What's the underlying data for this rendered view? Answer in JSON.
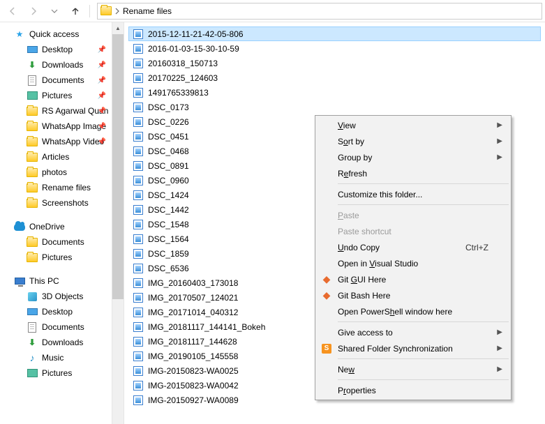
{
  "toolbar": {
    "breadcrumb": "Rename files"
  },
  "sidebar": {
    "quick_access": {
      "label": "Quick access",
      "items": [
        {
          "label": "Desktop",
          "icon": "desktop",
          "pinned": true
        },
        {
          "label": "Downloads",
          "icon": "downloads",
          "pinned": true
        },
        {
          "label": "Documents",
          "icon": "docs",
          "pinned": true
        },
        {
          "label": "Pictures",
          "icon": "pics",
          "pinned": true
        },
        {
          "label": "RS Agarwal Quan",
          "icon": "folder",
          "pinned": true
        },
        {
          "label": "WhatsApp Image",
          "icon": "folder",
          "pinned": true
        },
        {
          "label": "WhatsApp Video",
          "icon": "folder",
          "pinned": true
        },
        {
          "label": "Articles",
          "icon": "folder",
          "pinned": false
        },
        {
          "label": "photos",
          "icon": "folder",
          "pinned": false
        },
        {
          "label": "Rename files",
          "icon": "folder",
          "pinned": false
        },
        {
          "label": "Screenshots",
          "icon": "folder",
          "pinned": false
        }
      ]
    },
    "onedrive": {
      "label": "OneDrive",
      "items": [
        {
          "label": "Documents",
          "icon": "folder"
        },
        {
          "label": "Pictures",
          "icon": "folder"
        }
      ]
    },
    "this_pc": {
      "label": "This PC",
      "items": [
        {
          "label": "3D Objects",
          "icon": "obj3d"
        },
        {
          "label": "Desktop",
          "icon": "desktop"
        },
        {
          "label": "Documents",
          "icon": "docs"
        },
        {
          "label": "Downloads",
          "icon": "downloads"
        },
        {
          "label": "Music",
          "icon": "music"
        },
        {
          "label": "Pictures",
          "icon": "pics"
        }
      ]
    }
  },
  "files": [
    "2015-12-11-21-42-05-806",
    "2016-01-03-15-30-10-59",
    "20160318_150713",
    "20170225_124603",
    "1491765339813",
    "DSC_0173",
    "DSC_0226",
    "DSC_0451",
    "DSC_0468",
    "DSC_0891",
    "DSC_0960",
    "DSC_1424",
    "DSC_1442",
    "DSC_1548",
    "DSC_1564",
    "DSC_1859",
    "DSC_6536",
    "IMG_20160403_173018",
    "IMG_20170507_124021",
    "IMG_20171014_040312",
    "IMG_20181117_144141_Bokeh",
    "IMG_20181117_144628",
    "IMG_20190105_145558",
    "IMG-20150823-WA0025",
    "IMG-20150823-WA0042",
    "IMG-20150927-WA0089"
  ],
  "selected_index": 0,
  "context_menu": {
    "view": "View",
    "sort": "Sort by",
    "group": "Group by",
    "refresh": "Refresh",
    "customize": "Customize this folder...",
    "paste": "Paste",
    "paste_shortcut": "Paste shortcut",
    "undo": "Undo Copy",
    "undo_key": "Ctrl+Z",
    "open_vs": "Open in Visual Studio",
    "git_gui": "Git GUI Here",
    "git_bash": "Git Bash Here",
    "powershell": "Open PowerShell window here",
    "give_access": "Give access to",
    "shared_sync": "Shared Folder Synchronization",
    "new": "New",
    "properties": "Properties"
  }
}
